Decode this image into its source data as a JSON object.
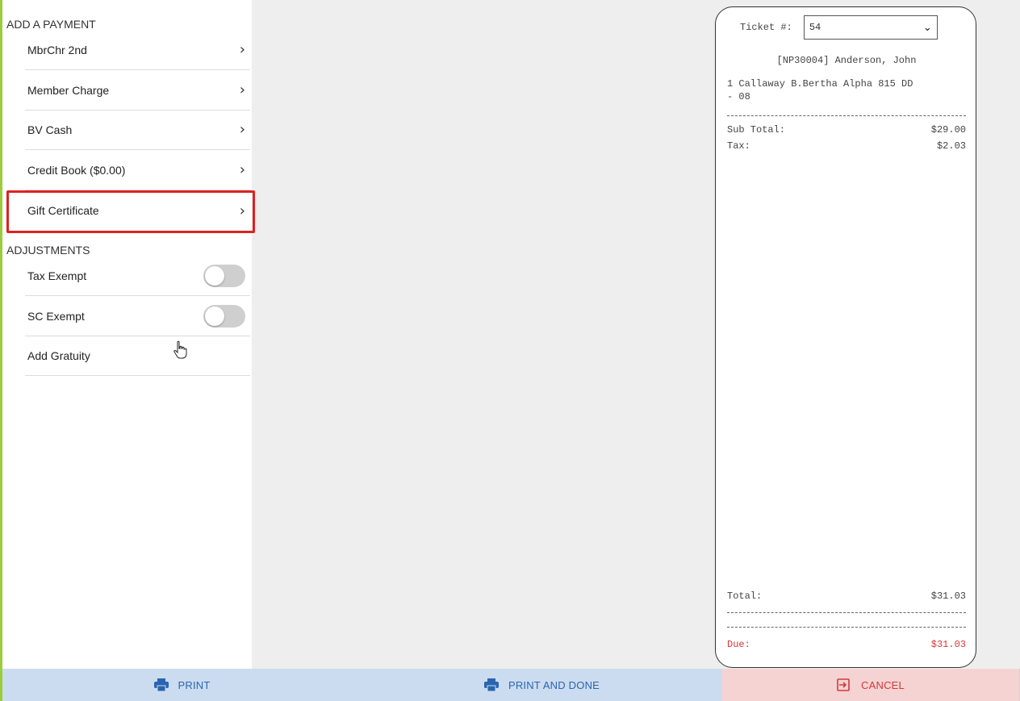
{
  "payments": {
    "title": "ADD A PAYMENT",
    "items": [
      {
        "label": "MbrChr 2nd"
      },
      {
        "label": "Member Charge"
      },
      {
        "label": "BV Cash"
      },
      {
        "label": "Credit Book ($0.00)"
      },
      {
        "label": "Gift Certificate"
      }
    ]
  },
  "adjustments": {
    "title": "ADJUSTMENTS",
    "items": [
      {
        "label": "Tax Exempt",
        "enabled": false
      },
      {
        "label": "SC Exempt",
        "enabled": false
      },
      {
        "label": "Add Gratuity"
      }
    ]
  },
  "receipt": {
    "ticket_label": "Ticket #:",
    "ticket_value": "54",
    "customer": "[NP30004] Anderson, John",
    "item_line1": "1 Callaway B.Bertha Alpha 815 DD",
    "item_line2": "- 08",
    "subtotal_label": "Sub Total:",
    "subtotal_value": "$29.00",
    "tax_label": "Tax:",
    "tax_value": "$2.03",
    "total_label": "Total:",
    "total_value": "$31.03",
    "due_label": "Due:",
    "due_value": "$31.03"
  },
  "buttons": {
    "print": "PRINT",
    "print_done": "PRINT AND DONE",
    "cancel": "CANCEL"
  },
  "colors": {
    "highlight": "#e02020",
    "primary_button_bg": "#ccdcf0",
    "primary_button_text": "#2a65b0",
    "cancel_button_bg": "#f6d3d3",
    "cancel_button_text": "#d23a3a",
    "due_text": "#dd3333"
  }
}
